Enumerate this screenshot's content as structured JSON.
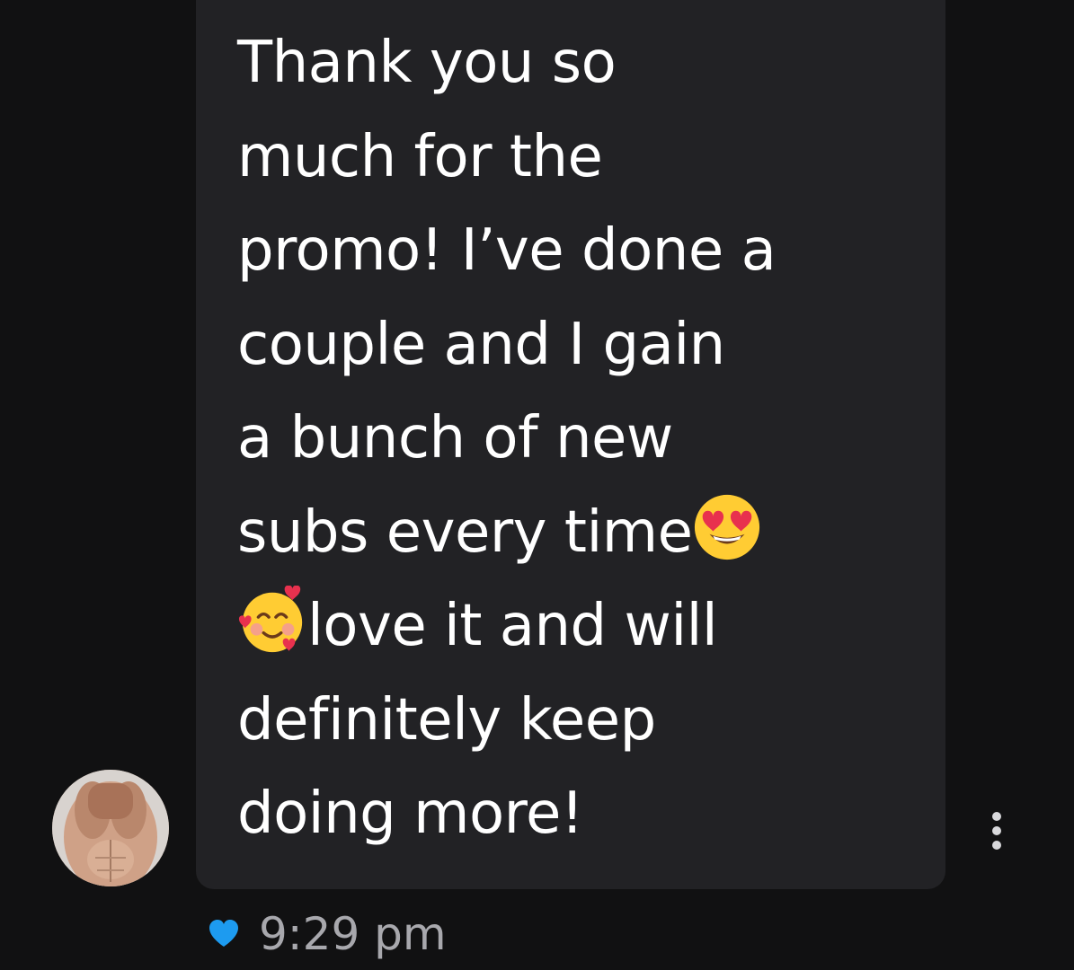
{
  "message": {
    "segments": [
      {
        "text": "Thank you so\nmuch for the\npromo! I’ve done a\ncouple and I gain\na bunch of new\nsubs every time"
      },
      {
        "emoji": "smiling-face-with-heart-eyes-icon"
      },
      {
        "text": "\n"
      },
      {
        "emoji": "smiling-face-with-hearts-icon"
      },
      {
        "text": "love it and will\ndefinitely keep\ndoing more!"
      }
    ],
    "timestamp": "9:29 pm",
    "liked": true
  },
  "colors": {
    "background": "#111112",
    "bubble": "#222225",
    "text": "#ffffff",
    "timestamp": "#a8a8ad",
    "heart": "#1d9bf0"
  },
  "icons": [
    "avatar",
    "smiling-face-with-heart-eyes-icon",
    "smiling-face-with-hearts-icon",
    "more-options-icon",
    "heart-icon"
  ]
}
